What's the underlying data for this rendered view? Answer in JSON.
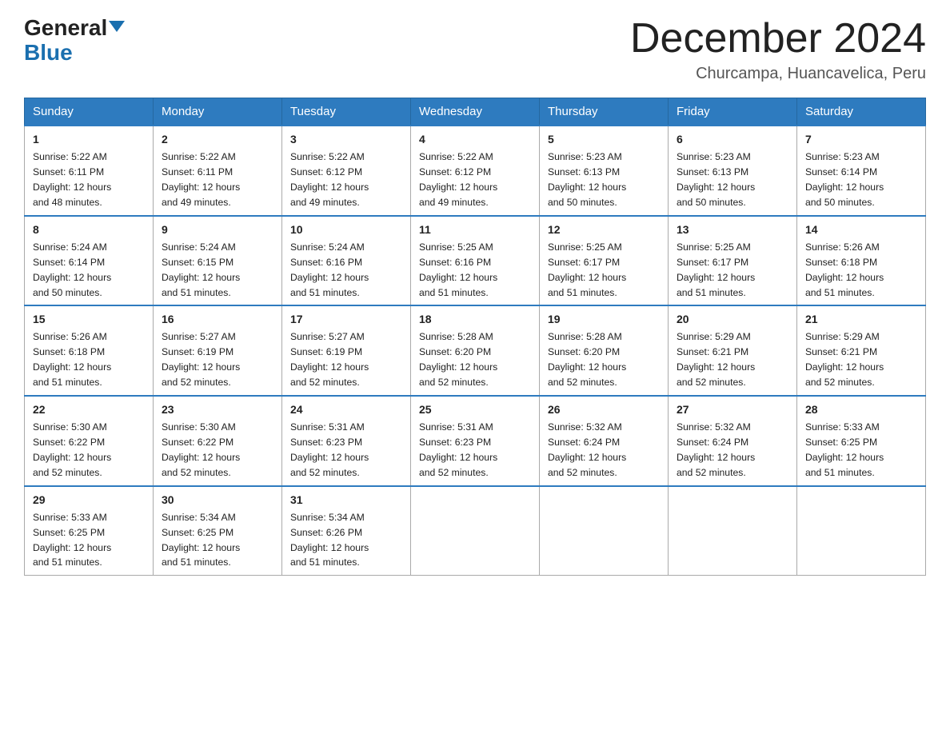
{
  "logo": {
    "general": "General",
    "blue": "Blue"
  },
  "title": {
    "month": "December 2024",
    "location": "Churcampa, Huancavelica, Peru"
  },
  "headers": [
    "Sunday",
    "Monday",
    "Tuesday",
    "Wednesday",
    "Thursday",
    "Friday",
    "Saturday"
  ],
  "weeks": [
    [
      {
        "day": "1",
        "sunrise": "5:22 AM",
        "sunset": "6:11 PM",
        "daylight": "12 hours and 48 minutes."
      },
      {
        "day": "2",
        "sunrise": "5:22 AM",
        "sunset": "6:11 PM",
        "daylight": "12 hours and 49 minutes."
      },
      {
        "day": "3",
        "sunrise": "5:22 AM",
        "sunset": "6:12 PM",
        "daylight": "12 hours and 49 minutes."
      },
      {
        "day": "4",
        "sunrise": "5:22 AM",
        "sunset": "6:12 PM",
        "daylight": "12 hours and 49 minutes."
      },
      {
        "day": "5",
        "sunrise": "5:23 AM",
        "sunset": "6:13 PM",
        "daylight": "12 hours and 50 minutes."
      },
      {
        "day": "6",
        "sunrise": "5:23 AM",
        "sunset": "6:13 PM",
        "daylight": "12 hours and 50 minutes."
      },
      {
        "day": "7",
        "sunrise": "5:23 AM",
        "sunset": "6:14 PM",
        "daylight": "12 hours and 50 minutes."
      }
    ],
    [
      {
        "day": "8",
        "sunrise": "5:24 AM",
        "sunset": "6:14 PM",
        "daylight": "12 hours and 50 minutes."
      },
      {
        "day": "9",
        "sunrise": "5:24 AM",
        "sunset": "6:15 PM",
        "daylight": "12 hours and 51 minutes."
      },
      {
        "day": "10",
        "sunrise": "5:24 AM",
        "sunset": "6:16 PM",
        "daylight": "12 hours and 51 minutes."
      },
      {
        "day": "11",
        "sunrise": "5:25 AM",
        "sunset": "6:16 PM",
        "daylight": "12 hours and 51 minutes."
      },
      {
        "day": "12",
        "sunrise": "5:25 AM",
        "sunset": "6:17 PM",
        "daylight": "12 hours and 51 minutes."
      },
      {
        "day": "13",
        "sunrise": "5:25 AM",
        "sunset": "6:17 PM",
        "daylight": "12 hours and 51 minutes."
      },
      {
        "day": "14",
        "sunrise": "5:26 AM",
        "sunset": "6:18 PM",
        "daylight": "12 hours and 51 minutes."
      }
    ],
    [
      {
        "day": "15",
        "sunrise": "5:26 AM",
        "sunset": "6:18 PM",
        "daylight": "12 hours and 51 minutes."
      },
      {
        "day": "16",
        "sunrise": "5:27 AM",
        "sunset": "6:19 PM",
        "daylight": "12 hours and 52 minutes."
      },
      {
        "day": "17",
        "sunrise": "5:27 AM",
        "sunset": "6:19 PM",
        "daylight": "12 hours and 52 minutes."
      },
      {
        "day": "18",
        "sunrise": "5:28 AM",
        "sunset": "6:20 PM",
        "daylight": "12 hours and 52 minutes."
      },
      {
        "day": "19",
        "sunrise": "5:28 AM",
        "sunset": "6:20 PM",
        "daylight": "12 hours and 52 minutes."
      },
      {
        "day": "20",
        "sunrise": "5:29 AM",
        "sunset": "6:21 PM",
        "daylight": "12 hours and 52 minutes."
      },
      {
        "day": "21",
        "sunrise": "5:29 AM",
        "sunset": "6:21 PM",
        "daylight": "12 hours and 52 minutes."
      }
    ],
    [
      {
        "day": "22",
        "sunrise": "5:30 AM",
        "sunset": "6:22 PM",
        "daylight": "12 hours and 52 minutes."
      },
      {
        "day": "23",
        "sunrise": "5:30 AM",
        "sunset": "6:22 PM",
        "daylight": "12 hours and 52 minutes."
      },
      {
        "day": "24",
        "sunrise": "5:31 AM",
        "sunset": "6:23 PM",
        "daylight": "12 hours and 52 minutes."
      },
      {
        "day": "25",
        "sunrise": "5:31 AM",
        "sunset": "6:23 PM",
        "daylight": "12 hours and 52 minutes."
      },
      {
        "day": "26",
        "sunrise": "5:32 AM",
        "sunset": "6:24 PM",
        "daylight": "12 hours and 52 minutes."
      },
      {
        "day": "27",
        "sunrise": "5:32 AM",
        "sunset": "6:24 PM",
        "daylight": "12 hours and 52 minutes."
      },
      {
        "day": "28",
        "sunrise": "5:33 AM",
        "sunset": "6:25 PM",
        "daylight": "12 hours and 51 minutes."
      }
    ],
    [
      {
        "day": "29",
        "sunrise": "5:33 AM",
        "sunset": "6:25 PM",
        "daylight": "12 hours and 51 minutes."
      },
      {
        "day": "30",
        "sunrise": "5:34 AM",
        "sunset": "6:25 PM",
        "daylight": "12 hours and 51 minutes."
      },
      {
        "day": "31",
        "sunrise": "5:34 AM",
        "sunset": "6:26 PM",
        "daylight": "12 hours and 51 minutes."
      },
      null,
      null,
      null,
      null
    ]
  ],
  "labels": {
    "sunrise": "Sunrise:",
    "sunset": "Sunset:",
    "daylight": "Daylight:"
  }
}
